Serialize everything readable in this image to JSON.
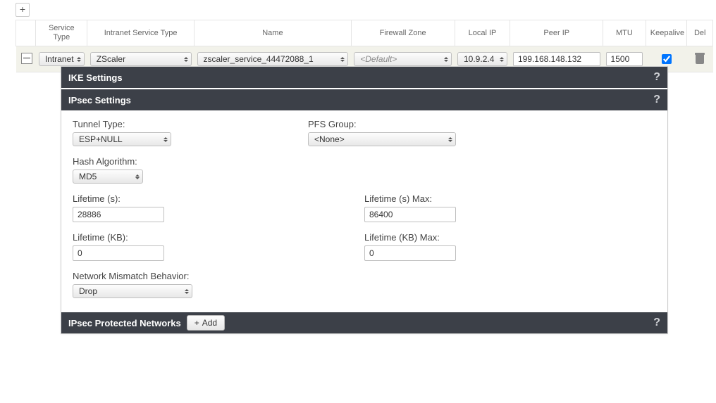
{
  "toolbar": {
    "add_row_label": "+"
  },
  "grid": {
    "headers": {
      "service_type": "Service\nType",
      "intranet_service_type": "Intranet Service Type",
      "name": "Name",
      "firewall_zone": "Firewall Zone",
      "local_ip": "Local IP",
      "peer_ip": "Peer IP",
      "mtu": "MTU",
      "keepalive": "Keepalive",
      "del": "Del"
    },
    "row": {
      "service_type": "Intranet",
      "intranet_service_type": "ZScaler",
      "name": "zscaler_service_44472088_1",
      "firewall_zone_placeholder": "<Default>",
      "local_ip": "10.9.2.4",
      "peer_ip": "199.168.148.132",
      "mtu": "1500",
      "keepalive_checked": true
    }
  },
  "sections": {
    "ike_settings": "IKE Settings",
    "ipsec_settings": "IPsec Settings",
    "ipsec_protected_networks": "IPsec Protected Networks",
    "add_button_label": "Add"
  },
  "ipsec": {
    "tunnel_type": {
      "label": "Tunnel Type:",
      "value": "ESP+NULL"
    },
    "pfs_group": {
      "label": "PFS Group:",
      "value": "<None>"
    },
    "hash_algorithm": {
      "label": "Hash Algorithm:",
      "value": "MD5"
    },
    "lifetime_s": {
      "label": "Lifetime (s):",
      "value": "28886"
    },
    "lifetime_s_max": {
      "label": "Lifetime (s) Max:",
      "value": "86400"
    },
    "lifetime_kb": {
      "label": "Lifetime (KB):",
      "value": "0"
    },
    "lifetime_kb_max": {
      "label": "Lifetime (KB) Max:",
      "value": "0"
    },
    "network_mismatch_behavior": {
      "label": "Network Mismatch Behavior:",
      "value": "Drop"
    }
  }
}
